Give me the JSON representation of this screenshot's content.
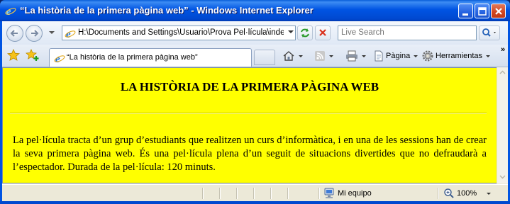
{
  "window": {
    "title": "“La història de la primera pàgina web” - Windows Internet Explorer"
  },
  "address_bar": {
    "value": "H:\\Documents and Settings\\Usuario\\Prova Pel·lícula\\index.htm"
  },
  "search": {
    "placeholder": "Live Search"
  },
  "tab": {
    "label": "“La història de la primera pàgina web”"
  },
  "command_bar": {
    "page_label": "Pàgina",
    "tools_label": "Herramientas"
  },
  "page": {
    "heading": "LA HISTÒRIA DE LA PRIMERA PÀGINA WEB",
    "paragraph": "La pel·lícula tracta d’un grup d’estudiants que realitzen un curs d’informàtica, i en una de les sessions han de crear la seva primera pàgina web. És una pel·lícula plena d’un seguit de situacions divertides que no defraudarà a l’espectador. Durada de la pel·lícula: 120 minuts.",
    "background_color": "#ffff00"
  },
  "status_bar": {
    "zone": "Mi equipo",
    "zoom": "100%"
  },
  "icons": [
    "ie-icon",
    "minimize-icon",
    "maximize-icon",
    "close-icon",
    "back-arrow-icon",
    "forward-arrow-icon",
    "refresh-icon",
    "stop-icon",
    "search-icon",
    "favorites-star-icon",
    "add-favorites-icon",
    "home-icon",
    "feeds-icon",
    "print-icon",
    "page-icon",
    "tools-gear-icon",
    "computer-icon",
    "zoom-icon"
  ]
}
